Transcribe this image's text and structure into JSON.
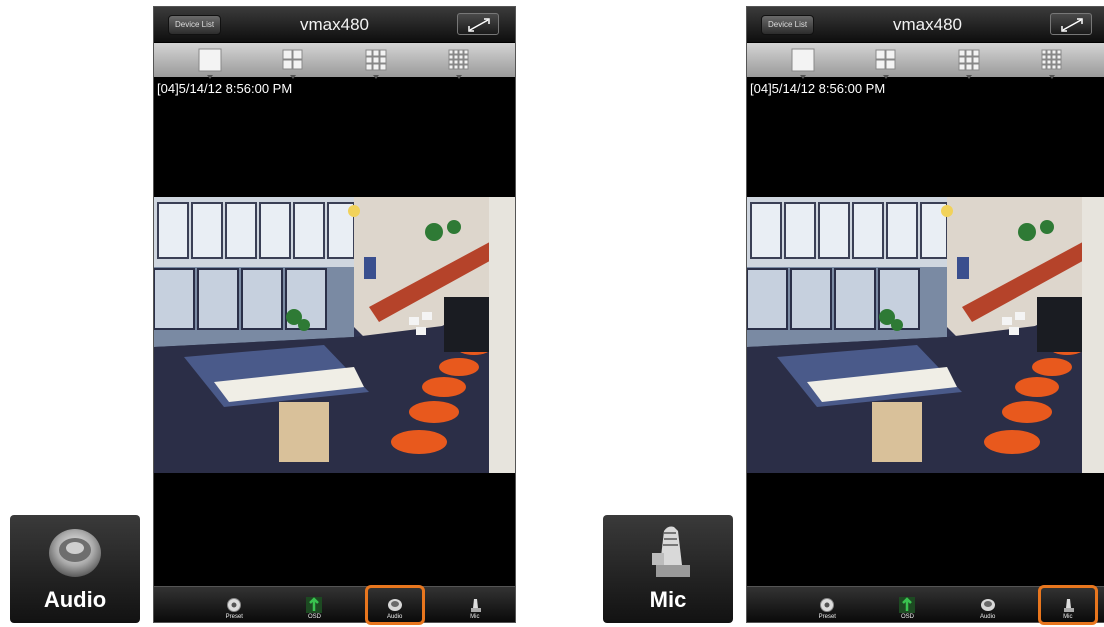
{
  "callouts": {
    "left": {
      "label": "Audio",
      "icon": "speaker-icon"
    },
    "right": {
      "label": "Mic",
      "icon": "microphone-icon"
    }
  },
  "phones": [
    {
      "nav": {
        "back_label": "Device List",
        "title": "vmax480",
        "expand_icon": "expand-icon"
      },
      "layout_buttons": [
        "layout-1x1-icon",
        "layout-2x2-icon",
        "layout-3x3-icon",
        "layout-4x4-icon"
      ],
      "timestamp": "[04]5/14/12 8:56:00 PM",
      "toolbar": {
        "items": [
          {
            "label": "Preset",
            "icon": "preset-icon"
          },
          {
            "label": "OSD",
            "icon": "osd-icon"
          },
          {
            "label": "Audio",
            "icon": "speaker-icon"
          },
          {
            "label": "Mic",
            "icon": "microphone-icon"
          }
        ],
        "highlighted": "Audio"
      }
    },
    {
      "nav": {
        "back_label": "Device List",
        "title": "vmax480",
        "expand_icon": "expand-icon"
      },
      "layout_buttons": [
        "layout-1x1-icon",
        "layout-2x2-icon",
        "layout-3x3-icon",
        "layout-4x4-icon"
      ],
      "timestamp": "[04]5/14/12 8:56:00 PM",
      "toolbar": {
        "items": [
          {
            "label": "Preset",
            "icon": "preset-icon"
          },
          {
            "label": "OSD",
            "icon": "osd-icon"
          },
          {
            "label": "Audio",
            "icon": "speaker-icon"
          },
          {
            "label": "Mic",
            "icon": "microphone-icon"
          }
        ],
        "highlighted": "Mic"
      }
    }
  ],
  "colors": {
    "highlight": "#e8761e",
    "osd_green": "#1f9a3a"
  }
}
